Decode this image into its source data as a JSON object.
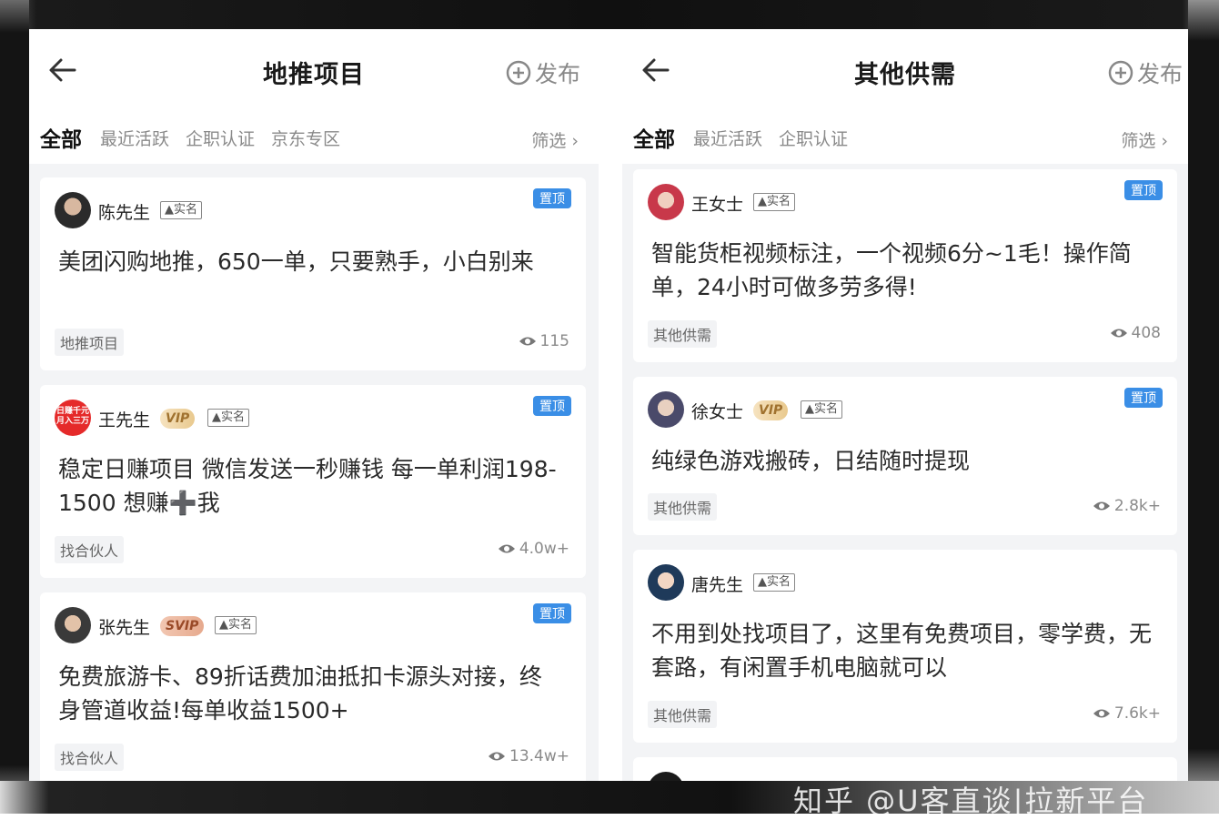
{
  "colors": {
    "accent": "#3a8ee6",
    "frame": "#111111",
    "panel_bg": "#f3f4f6"
  },
  "watermark": "知乎 @U客直谈|拉新平台",
  "left_panel": {
    "title": "地推项目",
    "publish_label": "发布",
    "tabs": [
      "全部",
      "最近活跃",
      "企职认证",
      "京东专区"
    ],
    "filter_label": "筛选",
    "posts": [
      {
        "user": "陈先生",
        "vip": "",
        "realname": "实名",
        "pin": "置顶",
        "content": "美团闪购地推，650一单，只要熟手，小白别来",
        "tag": "地推项目",
        "views": "115"
      },
      {
        "user": "王先生",
        "vip": "VIP",
        "realname": "实名",
        "pin": "置顶",
        "content": "稳定日赚项目 微信发送一秒赚钱 每一单利润198-1500 想赚➕我",
        "tag": "找合伙人",
        "views": "4.0w+",
        "avatar_text": "日赚千元月入三万"
      },
      {
        "user": "张先生",
        "vip": "SVIP",
        "realname": "实名",
        "pin": "置顶",
        "content": "免费旅游卡、89折话费加油抵扣卡源头对接，终身管道收益!每单收益1500+",
        "tag": "找合伙人",
        "views": "13.4w+"
      }
    ]
  },
  "right_panel": {
    "title": "其他供需",
    "publish_label": "发布",
    "tabs": [
      "全部",
      "最近活跃",
      "企职认证"
    ],
    "filter_label": "筛选",
    "posts": [
      {
        "user": "王女士",
        "vip": "",
        "realname": "实名",
        "pin": "置顶",
        "content": "智能货柜视频标注，一个视频6分~1毛！操作简单，24小时可做多劳多得!",
        "tag": "其他供需",
        "views": "408"
      },
      {
        "user": "徐女士",
        "vip": "VIP",
        "realname": "实名",
        "pin": "置顶",
        "content": "纯绿色游戏搬砖，日结随时提现",
        "tag": "其他供需",
        "views": "2.8k+"
      },
      {
        "user": "唐先生",
        "vip": "",
        "realname": "实名",
        "pin": "",
        "content": "不用到处找项目了，这里有免费项目，零学费，无套路，有闲置手机电脑就可以",
        "tag": "其他供需",
        "views": "7.6k+"
      }
    ]
  }
}
